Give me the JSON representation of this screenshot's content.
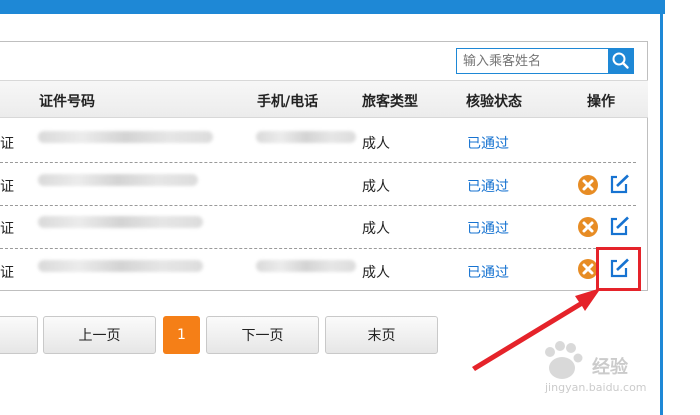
{
  "search": {
    "placeholder": "输入乘客姓名"
  },
  "table": {
    "headers": [
      "证件号码",
      "手机/电话",
      "旅客类型",
      "核验状态",
      "操作"
    ],
    "rows": [
      {
        "id_type": "证",
        "passenger_type": "成人",
        "status": "已通过",
        "show_actions": false
      },
      {
        "id_type": "证",
        "passenger_type": "成人",
        "status": "已通过",
        "show_actions": true
      },
      {
        "id_type": "证",
        "passenger_type": "成人",
        "status": "已通过",
        "show_actions": true
      },
      {
        "id_type": "证",
        "passenger_type": "成人",
        "status": "已通过",
        "show_actions": true
      }
    ]
  },
  "pagination": {
    "prev": "上一页",
    "current": "1",
    "next": "下一页",
    "last": "末页"
  },
  "watermark": {
    "brand": "经验",
    "url": "jingyan.baidu.com"
  },
  "icons": {
    "search": "search-icon",
    "cancel": "cancel-icon",
    "edit": "edit-icon"
  },
  "colors": {
    "accent": "#1e88d6",
    "status": "#1773d1",
    "cancel": "#e78c24",
    "current_page": "#f57f17",
    "highlight": "#e5232a"
  }
}
